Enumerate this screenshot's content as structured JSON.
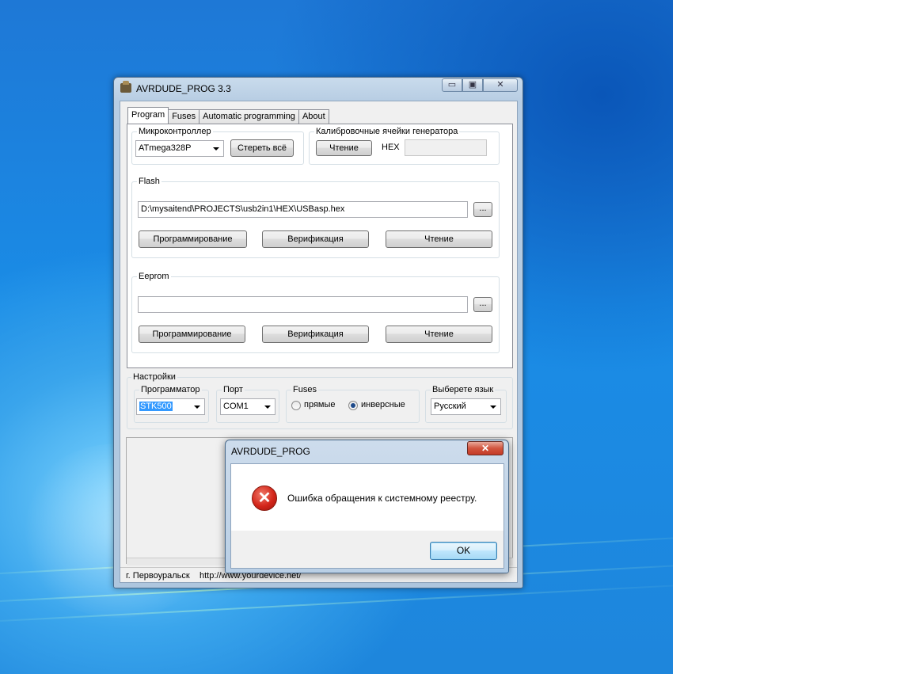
{
  "window": {
    "title": "AVRDUDE_PROG 3.3",
    "caption_min": "▭",
    "caption_max": "▣",
    "caption_close": "✕"
  },
  "tabs": [
    "Program",
    "Fuses",
    "Automatic programming",
    "About"
  ],
  "mcu": {
    "group_label": "Микроконтроллер",
    "selected": "ATmega328P",
    "erase_button": "Стереть всё"
  },
  "calib": {
    "group_label": "Калибровочные ячейки генератора",
    "read_button": "Чтение",
    "hex_label": "HEX",
    "hex_value": ""
  },
  "flash": {
    "group_label": "Flash",
    "path": "D:\\mysaitend\\PROJECTS\\usb2in1\\HEX\\USBasp.hex",
    "browse": "...",
    "program_button": "Программирование",
    "verify_button": "Верификация",
    "read_button": "Чтение"
  },
  "eeprom": {
    "group_label": "Eeprom",
    "path": "",
    "browse": "...",
    "program_button": "Программирование",
    "verify_button": "Верификация",
    "read_button": "Чтение"
  },
  "settings": {
    "label": "Настройки",
    "programmer_label": "Программатор",
    "programmer_value": "STK500",
    "port_label": "Порт",
    "port_value": "COM1",
    "fuses_label": "Fuses",
    "fuses_direct": "прямые",
    "fuses_inverse": "инверсные",
    "fuses_selected": "инверсные",
    "language_label": "Выберете язык",
    "language_value": "Русский"
  },
  "status": {
    "city": "г. Первоуральск",
    "url": "http://www.yourdevice.net/"
  },
  "dialog": {
    "title": "AVRDUDE_PROG",
    "close": "✕",
    "icon": "error-icon",
    "icon_glyph": "✕",
    "message": "Ошибка обращения к системному реестру.",
    "ok_button": "OK"
  }
}
